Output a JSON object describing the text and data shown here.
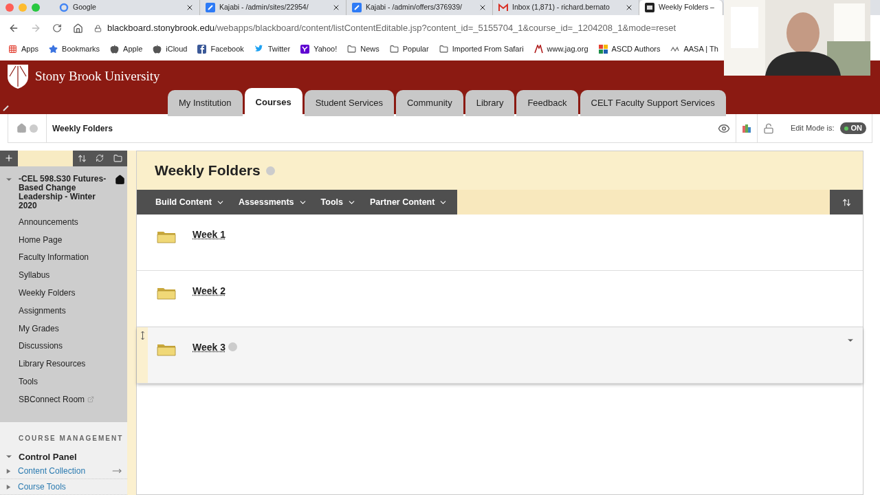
{
  "browser": {
    "tabs": [
      {
        "title": "Google",
        "kind": "google",
        "selected": false
      },
      {
        "title": "Kajabi - /admin/sites/22954/",
        "kind": "kajabi",
        "selected": false
      },
      {
        "title": "Kajabi - /admin/offers/376939/",
        "kind": "kajabi",
        "selected": false
      },
      {
        "title": "Inbox (1,871) - richard.bernato",
        "kind": "gmail",
        "selected": false
      },
      {
        "title": "Weekly Folders –",
        "kind": "bb",
        "selected": true
      }
    ],
    "url_host": "blackboard.stonybrook.edu",
    "url_path": "/webapps/blackboard/content/listContentEditable.jsp?content_id=_5155704_1&course_id=_1204208_1&mode=reset",
    "bookmarks": [
      {
        "label": "Apps",
        "kind": "apps"
      },
      {
        "label": "Bookmarks",
        "kind": "star"
      },
      {
        "label": "Apple",
        "kind": "apple"
      },
      {
        "label": "iCloud",
        "kind": "apple"
      },
      {
        "label": "Facebook",
        "kind": "facebook"
      },
      {
        "label": "Twitter",
        "kind": "twitter"
      },
      {
        "label": "Yahoo!",
        "kind": "yahoo"
      },
      {
        "label": "News",
        "kind": "folder"
      },
      {
        "label": "Popular",
        "kind": "folder"
      },
      {
        "label": "Imported From Safari",
        "kind": "folder"
      },
      {
        "label": "www.jag.org",
        "kind": "jag"
      },
      {
        "label": "ASCD Authors",
        "kind": "ascd"
      },
      {
        "label": "AASA | Th",
        "kind": "aasa"
      }
    ]
  },
  "header": {
    "logo": "Stony Brook University",
    "tabs": [
      {
        "label": "My Institution",
        "selected": false
      },
      {
        "label": "Courses",
        "selected": true
      },
      {
        "label": "Student Services",
        "selected": false
      },
      {
        "label": "Community",
        "selected": false
      },
      {
        "label": "Library",
        "selected": false
      },
      {
        "label": "Feedback",
        "selected": false
      },
      {
        "label": "CELT Faculty Support Services",
        "selected": false
      }
    ]
  },
  "breadcrumb": "Weekly Folders",
  "edit_mode": {
    "label": "Edit Mode is:",
    "value": "ON",
    "on": true
  },
  "sidebar": {
    "course_title": "-CEL 598.S30 Futures-Based Change Leadership - Winter 2020",
    "items": [
      "Announcements",
      "Home Page",
      "Faculty Information",
      "Syllabus",
      "Weekly Folders",
      "Assignments",
      "My Grades",
      "Discussions",
      "Library Resources",
      "Tools",
      "SBConnect Room"
    ],
    "management_heading": "COURSE MANAGEMENT",
    "control_panel": "Control Panel",
    "panel_items": [
      {
        "label": "Content Collection",
        "expanded": false
      },
      {
        "label": "Course Tools",
        "expanded": false
      }
    ]
  },
  "page_title": "Weekly Folders",
  "action_bar": [
    "Build Content",
    "Assessments",
    "Tools",
    "Partner Content"
  ],
  "folders": [
    {
      "title": "Week 1",
      "selected": false
    },
    {
      "title": "Week 2",
      "selected": false
    },
    {
      "title": "Week 3",
      "selected": true
    }
  ]
}
